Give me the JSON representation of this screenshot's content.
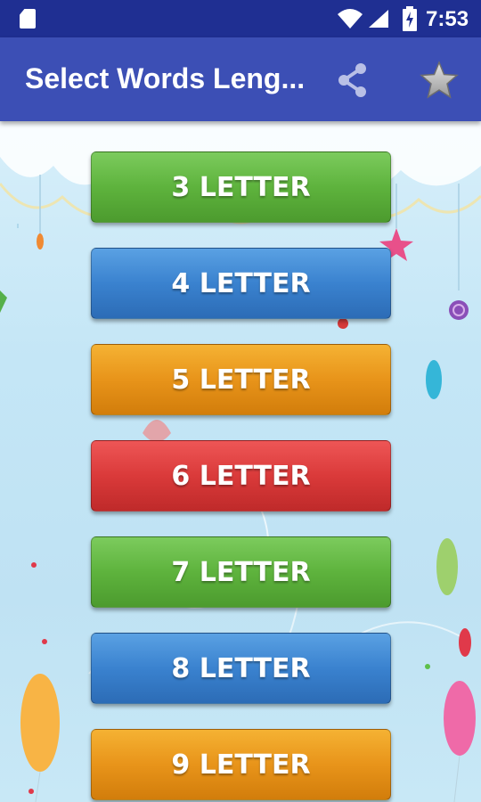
{
  "status_bar": {
    "time": "7:53"
  },
  "app_bar": {
    "title": "Select Words Leng..."
  },
  "buttons": [
    {
      "label": "3 LETTER",
      "color": "#5eb33d"
    },
    {
      "label": "4 LETTER",
      "color": "#3a82cf"
    },
    {
      "label": "5 LETTER",
      "color": "#e8941a"
    },
    {
      "label": "6 LETTER",
      "color": "#da3a3a"
    },
    {
      "label": "7 LETTER",
      "color": "#5eb33d"
    },
    {
      "label": "8 LETTER",
      "color": "#3a82cf"
    },
    {
      "label": "9 LETTER",
      "color": "#e8941a"
    }
  ],
  "icons": {
    "share": "share-icon",
    "rate": "star-icon"
  }
}
